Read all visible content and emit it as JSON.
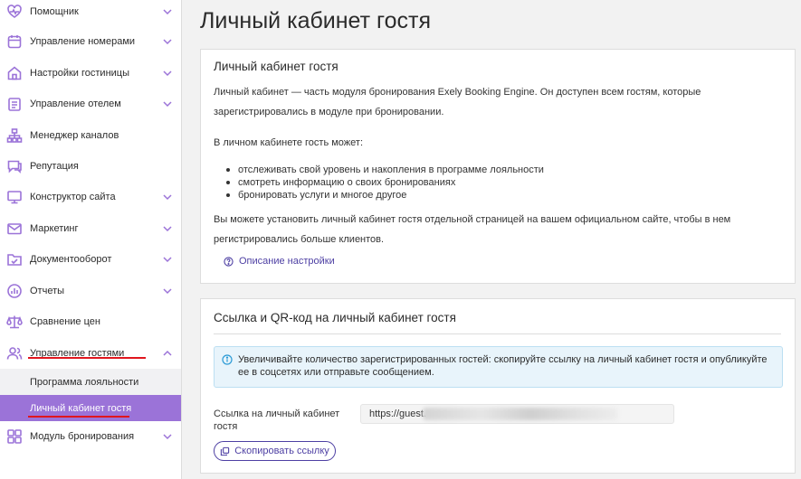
{
  "sidebar": {
    "items": [
      {
        "label": "Помощник"
      },
      {
        "label": "Управление номерами"
      },
      {
        "label": "Настройки гостиницы"
      },
      {
        "label": "Управление отелем"
      },
      {
        "label": "Менеджер каналов"
      },
      {
        "label": "Репутация"
      },
      {
        "label": "Конструктор сайта"
      },
      {
        "label": "Маркетинг"
      },
      {
        "label": "Документооборот"
      },
      {
        "label": "Отчеты"
      },
      {
        "label": "Сравнение цен"
      },
      {
        "label": "Управление гостями"
      },
      {
        "label": "Модуль бронирования"
      }
    ],
    "subitems": [
      {
        "label": "Программа лояльности"
      },
      {
        "label": "Личный кабинет гостя"
      }
    ]
  },
  "page": {
    "title": "Личный кабинет гостя"
  },
  "card1": {
    "title": "Личный кабинет гостя",
    "para1": "Личный кабинет — часть модуля бронирования Exely Booking Engine. Он доступен всем гостям, которые зарегистрировались в модуле при бронировании.",
    "para2": "В личном кабинете гость может:",
    "bullets": [
      "отслеживать свой уровень и накопления в программе лояльности",
      "смотреть информацию о своих бронированиях",
      "бронировать услуги и многое другое"
    ],
    "para3": "Вы можете установить личный кабинет гостя отдельной страницей на вашем официальном сайте, чтобы в нем регистрировались больше клиентов.",
    "help_link": "Описание настройки"
  },
  "card2": {
    "title": "Ссылка и QR-код на личный кабинет гостя",
    "info": "Увеличивайте количество зарегистрированных гостей: скопируйте ссылку на личный кабинет гостя и опубликуйте ее в соцсетях или отправьте сообщением.",
    "field_label": "Ссылка на личный кабинет гостя",
    "field_value": "https://guest.",
    "copy_button": "Скопировать ссылку"
  },
  "colors": {
    "accent": "#9b73d8",
    "link": "#4d3fa3",
    "underline": "#e0161e",
    "info_bg": "#e8f4fb"
  }
}
